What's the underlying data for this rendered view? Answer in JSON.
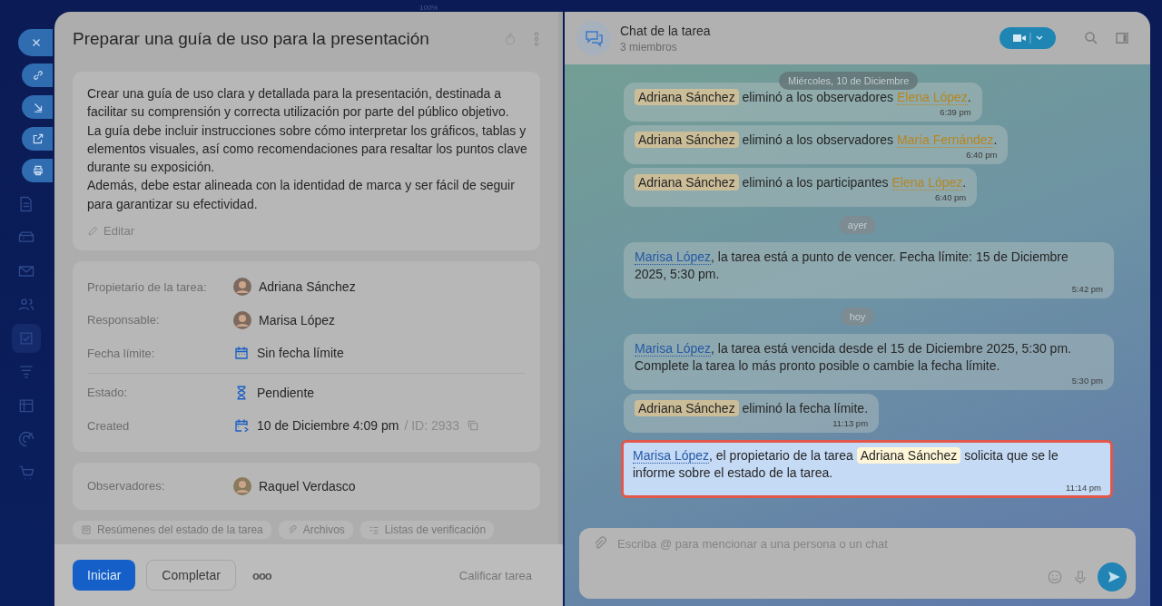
{
  "zoom_label": "100%",
  "task": {
    "title": "Preparar una guía de uso para la presentación",
    "description": [
      "Crear una guía de uso clara y detallada para la presentación, destinada a facilitar su comprensión y correcta utilización por parte del público objetivo.",
      "La guía debe incluir instrucciones sobre cómo interpretar los gráficos, tablas y elementos visuales, así como recomendaciones para resaltar los puntos clave durante su exposición.",
      "Además, debe estar alineada con la identidad de marca y ser fácil de seguir para garantizar su efectividad."
    ],
    "edit_label": "Editar",
    "details": [
      [
        {
          "label": "Propietario de la tarea:",
          "kind": "person",
          "value": "Adriana Sánchez"
        },
        {
          "label": "Responsable:",
          "kind": "person",
          "value": "Marisa López"
        },
        {
          "label": "Fecha límite:",
          "kind": "deadline",
          "value": "Sin fecha límite"
        }
      ],
      [
        {
          "label": "Estado:",
          "kind": "status",
          "value": "Pendiente"
        },
        {
          "label": "Created",
          "kind": "created",
          "value": "10 de Diciembre 4:09 pm",
          "extra": "/ ID: 2933"
        }
      ]
    ],
    "observers": {
      "label": "Observadores:",
      "value": "Raquel Verdasco"
    },
    "tabs": [
      {
        "label": "Resúmenes del estado de la tarea"
      },
      {
        "label": "Archivos"
      },
      {
        "label": "Listas de verificación"
      }
    ],
    "buttons": [
      {
        "label": "Iniciar",
        "kind": "primary"
      },
      {
        "label": "Completar",
        "kind": "secondary"
      }
    ],
    "more_label": "ooo",
    "rate_label": "Calificar tarea"
  },
  "chat": {
    "title": "Chat de la tarea",
    "subtitle": "3 miembros",
    "date_pill": "Miércoles, 10 de Diciembre",
    "items": [
      {
        "kind": "message",
        "highlighted": false,
        "time": "6:39 pm",
        "parts": [
          {
            "kind": "mention",
            "text": "Adriana Sánchez"
          },
          {
            "kind": "text",
            "text": " eliminó a los observadores "
          },
          {
            "kind": "user",
            "text": "Elena López"
          },
          {
            "kind": "text",
            "text": "."
          }
        ]
      },
      {
        "kind": "message",
        "highlighted": false,
        "time": "6:40 pm",
        "parts": [
          {
            "kind": "mention",
            "text": "Adriana Sánchez"
          },
          {
            "kind": "text",
            "text": " eliminó a los observadores "
          },
          {
            "kind": "user",
            "text": "María Fernández"
          },
          {
            "kind": "text",
            "text": "."
          }
        ]
      },
      {
        "kind": "message",
        "highlighted": false,
        "time": "6:40 pm",
        "parts": [
          {
            "kind": "mention",
            "text": "Adriana Sánchez"
          },
          {
            "kind": "text",
            "text": " eliminó a los participantes "
          },
          {
            "kind": "user",
            "text": "Elena López"
          },
          {
            "kind": "text",
            "text": "."
          }
        ]
      },
      {
        "kind": "date",
        "label": "ayer"
      },
      {
        "kind": "message",
        "highlighted": false,
        "time": "5:42 pm",
        "parts": [
          {
            "kind": "link",
            "text": "Marisa López"
          },
          {
            "kind": "text",
            "text": ", la tarea está a punto de vencer. Fecha límite: 15 de Diciembre 2025, 5:30 pm."
          }
        ]
      },
      {
        "kind": "date",
        "label": "hoy"
      },
      {
        "kind": "message",
        "highlighted": false,
        "time": "5:30 pm",
        "parts": [
          {
            "kind": "link",
            "text": "Marisa López"
          },
          {
            "kind": "text",
            "text": ", la tarea está vencida desde el 15 de Diciembre 2025, 5:30 pm. Complete la tarea lo más pronto posible o cambie la fecha límite."
          }
        ]
      },
      {
        "kind": "message",
        "highlighted": false,
        "time": "11:13 pm",
        "parts": [
          {
            "kind": "mention",
            "text": "Adriana Sánchez"
          },
          {
            "kind": "text",
            "text": " eliminó la fecha límite."
          }
        ]
      },
      {
        "kind": "message",
        "highlighted": true,
        "time": "11:14 pm",
        "parts": [
          {
            "kind": "link",
            "text": "Marisa López"
          },
          {
            "kind": "text",
            "text": ", el propietario de la tarea "
          },
          {
            "kind": "mention",
            "text": "Adriana Sánchez"
          },
          {
            "kind": "text",
            "text": " solicita que se le informe sobre el estado de la tarea."
          }
        ]
      }
    ],
    "composer": {
      "placeholder": "Escriba @ para mencionar a una persona o un chat"
    }
  }
}
